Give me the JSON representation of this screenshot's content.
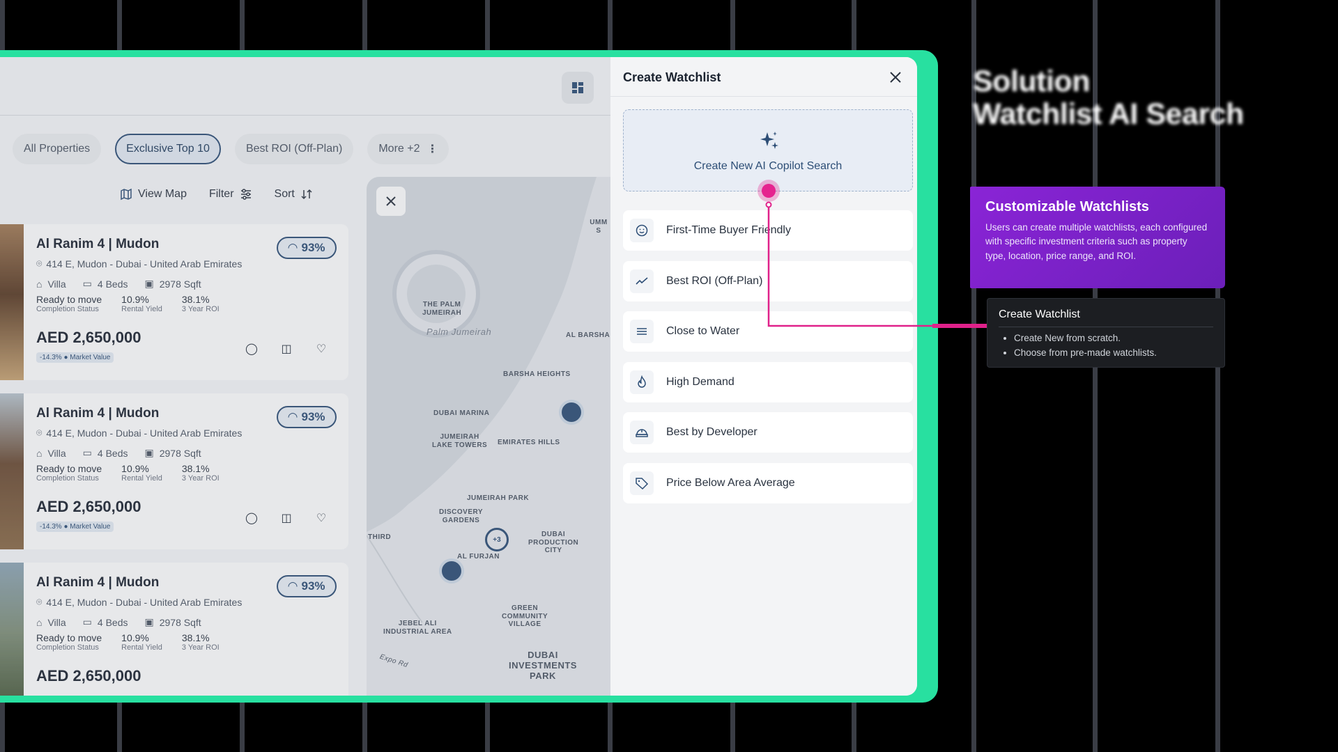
{
  "annotation": {
    "headline_line1": "Solution",
    "headline_line2": "Watchlist AI Search",
    "callout_title": "Customizable Watchlists",
    "callout_body": "Users can create multiple watchlists, each configured with specific investment criteria such as property type, location, price range, and ROI.",
    "tip_title": "Create Watchlist",
    "tip_items": [
      "Create New from scratch.",
      "Choose from pre-made watchlists."
    ]
  },
  "chips": [
    "All Properties",
    "Exclusive Top 10",
    "Best ROI (Off-Plan)",
    "More +2"
  ],
  "toolbar": {
    "view_map": "View Map",
    "filter": "Filter",
    "sort": "Sort"
  },
  "listings": [
    {
      "title": "Al Ranim 4 | Mudon",
      "address": "414 E, Mudon - Dubai - United Arab Emirates",
      "type": "Villa",
      "beds": "4 Beds",
      "area": "2978 Sqft",
      "status": "Ready to move",
      "status_label": "Completion Status",
      "yield": "10.9%",
      "yield_label": "Rental Yield",
      "roi": "38.1%",
      "roi_label": "3 Year ROI",
      "price": "AED 2,650,000",
      "market": "-14.3% ● Market Value",
      "score": "93%"
    },
    {
      "title": "Al Ranim 4 | Mudon",
      "address": "414 E, Mudon - Dubai - United Arab Emirates",
      "type": "Villa",
      "beds": "4 Beds",
      "area": "2978 Sqft",
      "status": "Ready to move",
      "status_label": "Completion Status",
      "yield": "10.9%",
      "yield_label": "Rental Yield",
      "roi": "38.1%",
      "roi_label": "3 Year ROI",
      "price": "AED 2,650,000",
      "market": "-14.3% ● Market Value",
      "score": "93%"
    },
    {
      "title": "Al Ranim 4 | Mudon",
      "address": "414 E, Mudon - Dubai - United Arab Emirates",
      "type": "Villa",
      "beds": "4 Beds",
      "area": "2978 Sqft",
      "status": "Ready to move",
      "status_label": "Completion Status",
      "yield": "10.9%",
      "yield_label": "Rental Yield",
      "roi": "38.1%",
      "roi_label": "3 Year ROI",
      "price": "AED 2,650,000",
      "market": "",
      "score": "93%"
    }
  ],
  "map_labels": {
    "palm": "THE PALM\nJUMEIRAH",
    "palm_italic": "Palm Jumeirah",
    "barsha": "BARSHA HEIGHTS",
    "marina": "DUBAI MARINA",
    "jlt": "JUMEIRAH\nLAKE TOWERS",
    "emirates_hills": "EMIRATES HILLS",
    "jvc": "JUMEIRAH PARK",
    "discovery": "DISCOVERY\nGARDENS",
    "furjan": "AL FURJAN",
    "production": "DUBAI\nPRODUCTION\nCITY",
    "jebel": "JEBEL ALI\nINDUSTRIAL AREA",
    "green": "GREEN\nCOMMUNITY\nVILLAGE",
    "dip": "DUBAI\nINVESTMENTS\nPARK",
    "umm": "UMM S",
    "albarsha": "AL BARSHA",
    "third": "THIRD",
    "expo": "Expo Rd",
    "cluster": "+3"
  },
  "watchlist": {
    "title": "Create Watchlist",
    "ai_label": "Create New AI Copilot Search",
    "options": [
      {
        "label": "First-Time Buyer Friendly",
        "icon": "smile-icon"
      },
      {
        "label": "Best ROI (Off-Plan)",
        "icon": "trend-icon"
      },
      {
        "label": "Close to Water",
        "icon": "waves-icon"
      },
      {
        "label": "High Demand",
        "icon": "flame-icon"
      },
      {
        "label": "Best by Developer",
        "icon": "helmet-icon"
      },
      {
        "label": "Price Below Area Average",
        "icon": "tag-icon"
      }
    ]
  },
  "colors": {
    "frame": "#28e0a0",
    "accent": "#2d4e76",
    "callout": "#8a24d6",
    "connector": "#e0218a"
  }
}
